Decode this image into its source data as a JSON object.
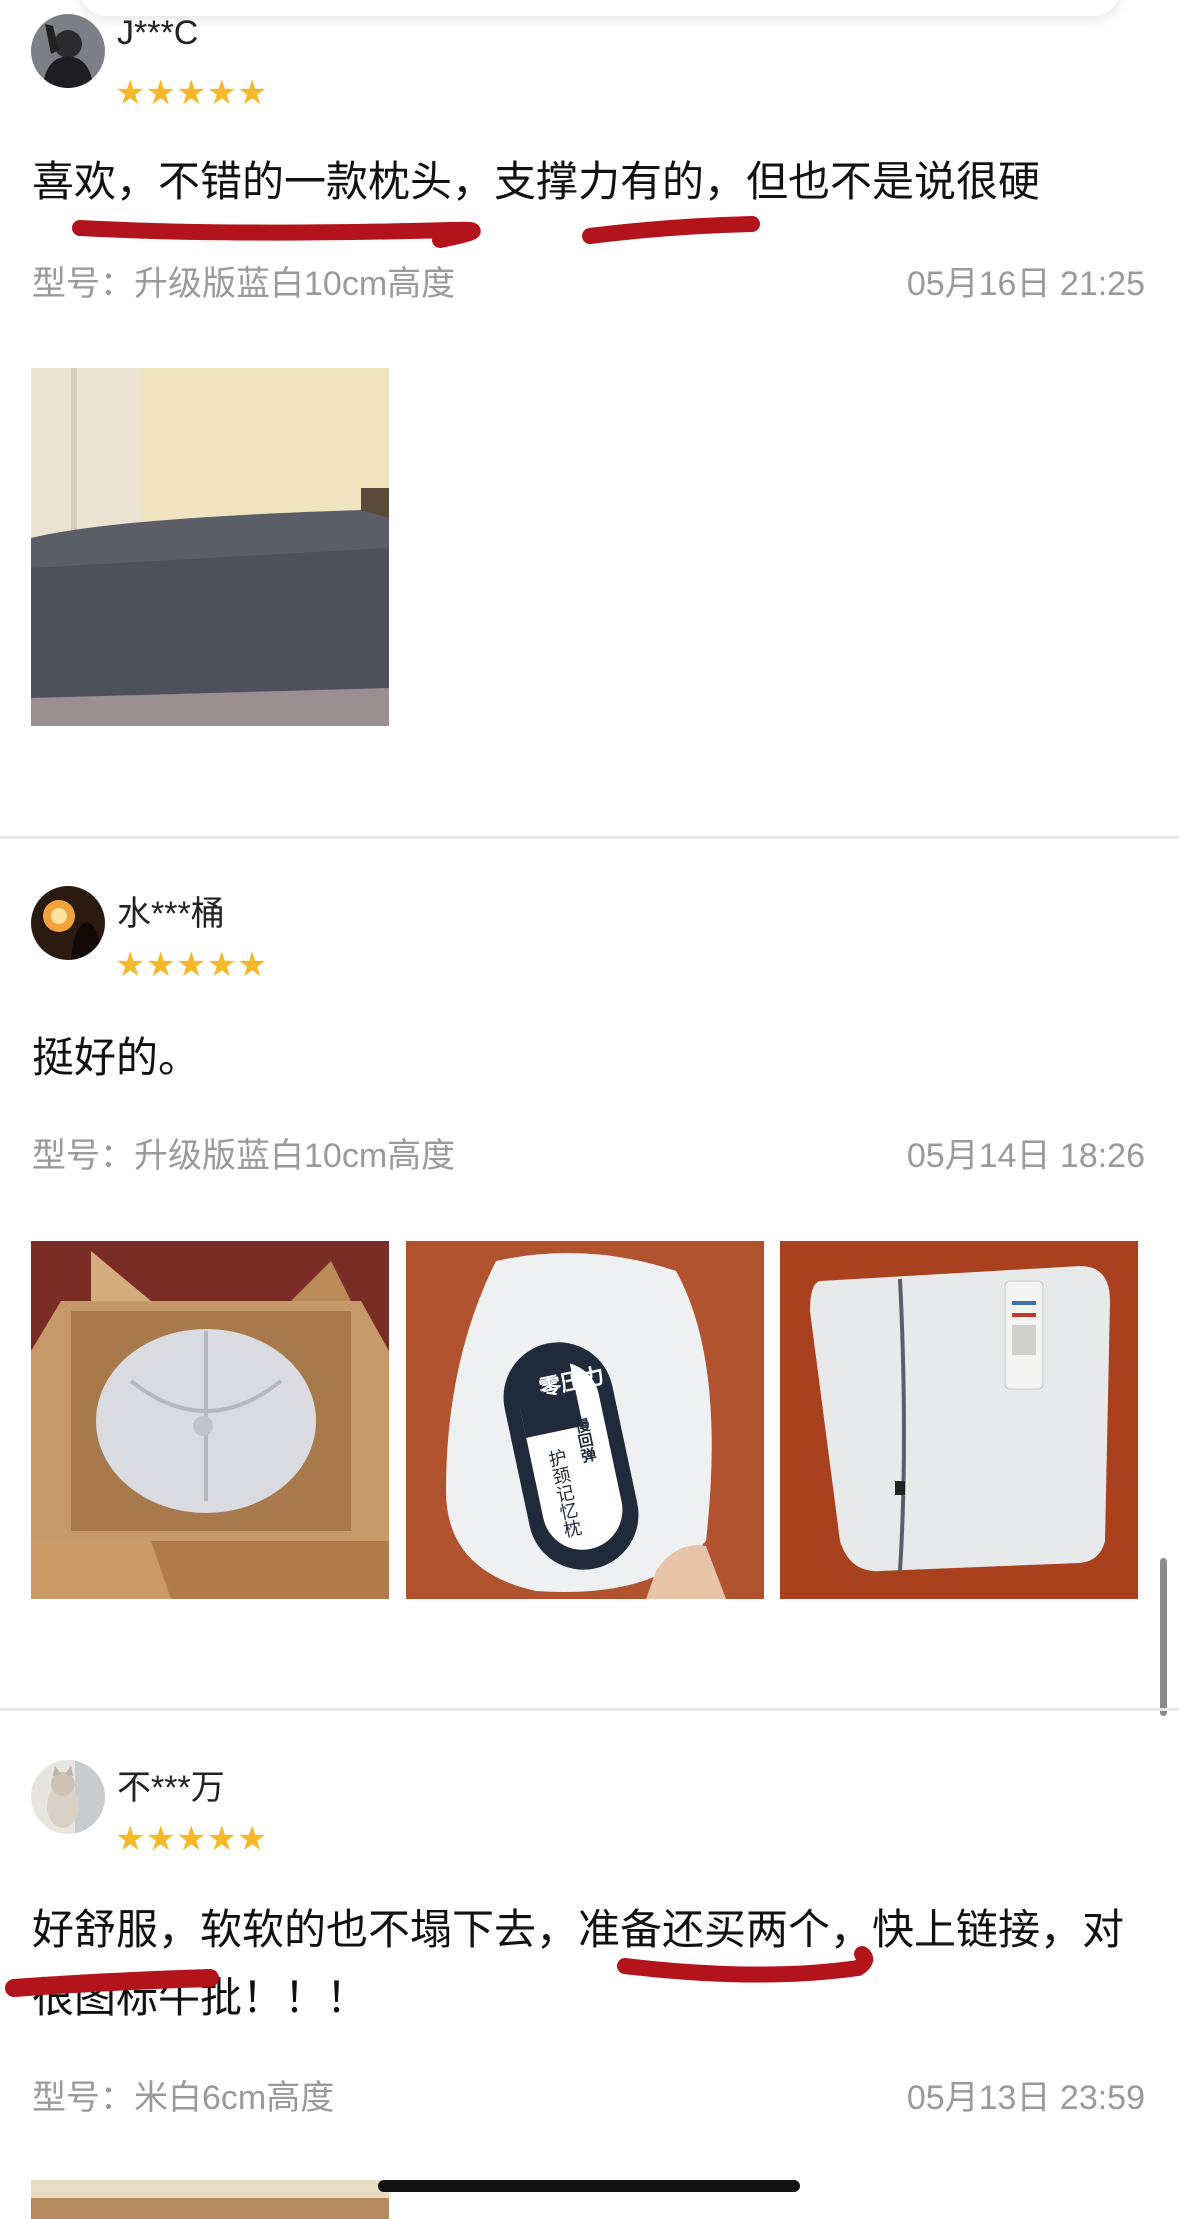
{
  "reviews": [
    {
      "user": "J***C",
      "rating": 5,
      "stars": "★★★★★",
      "text": "喜欢，不错的一款枕头，支撑力有的，但也不是说很硬",
      "model": "型号：升级版蓝白10cm高度",
      "date": "05月16日 21:25"
    },
    {
      "user": "水***桶",
      "rating": 5,
      "stars": "★★★★★",
      "text": "挺好的。",
      "model": "型号：升级版蓝白10cm高度",
      "date": "05月14日 18:26"
    },
    {
      "user": "不***万",
      "rating": 5,
      "stars": "★★★★★",
      "text": "好舒服，软软的也不塌下去，准备还买两个，快上链接，对很图标牛批！！！",
      "model": "型号：米白6cm高度",
      "date": "05月13日 23:59"
    }
  ],
  "photo_labels": {
    "packet_main": "零压力",
    "packet_sub": "慢回弹",
    "packet_name": "护颈记忆枕"
  },
  "colors": {
    "star": "#f5b829",
    "underline": "#b3131a",
    "meta": "#9a9a9a"
  }
}
